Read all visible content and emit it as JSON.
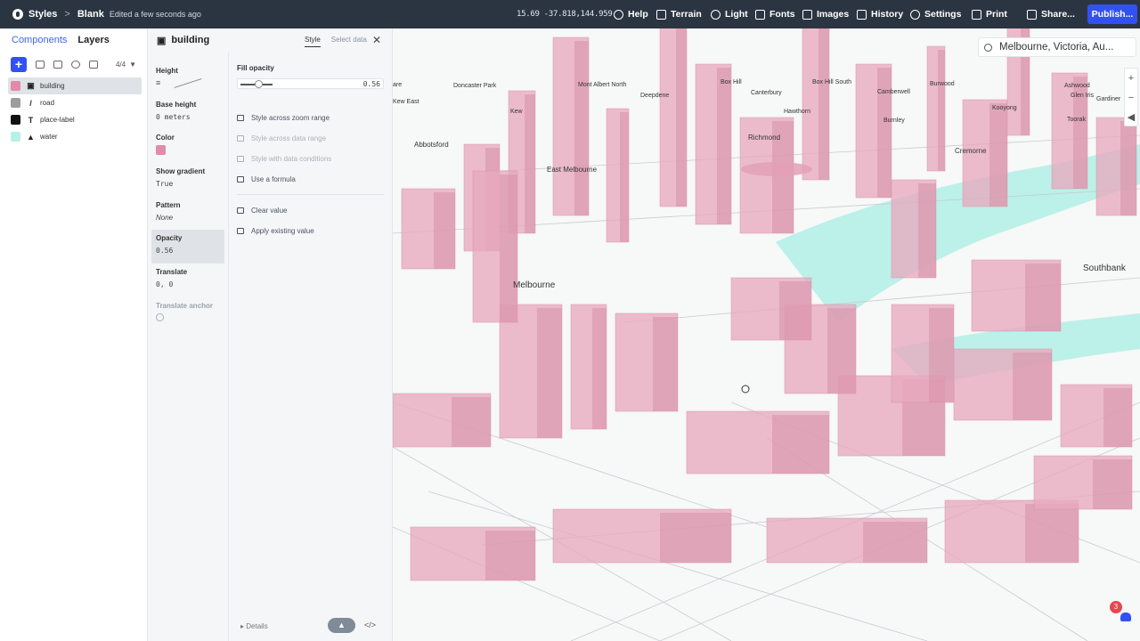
{
  "topbar": {
    "app_title": "Styles",
    "breadcrumb_separator": ">",
    "style_name": "Blank",
    "edited_status": "Edited a few seconds ago",
    "coords": "15.69 -37.818,144.959",
    "menu": [
      {
        "label": "Help",
        "icon": "help-icon"
      },
      {
        "label": "Terrain",
        "icon": "terrain-icon"
      },
      {
        "label": "Light",
        "icon": "light-icon"
      },
      {
        "label": "Fonts",
        "icon": "fonts-icon"
      },
      {
        "label": "Images",
        "icon": "images-icon"
      },
      {
        "label": "History",
        "icon": "history-icon"
      },
      {
        "label": "Settings",
        "icon": "settings-icon"
      },
      {
        "label": "Print",
        "icon": "print-icon"
      },
      {
        "label": "Share...",
        "icon": "share-icon"
      }
    ],
    "publish_label": "Publish..."
  },
  "left_panel": {
    "tabs": [
      {
        "label": "Components"
      },
      {
        "label": "Layers"
      }
    ],
    "active_tab": "Layers",
    "layer_count": "4/4",
    "layers": [
      {
        "name": "building",
        "color": "#e38aa7",
        "type_glyph": "▣",
        "selected": true
      },
      {
        "name": "road",
        "color": "#9e9e9e",
        "type_glyph": "/",
        "selected": false
      },
      {
        "name": "place-label",
        "color": "#111111",
        "type_glyph": "T",
        "selected": false
      },
      {
        "name": "water",
        "color": "#b7f1e6",
        "type_glyph": "▲",
        "selected": false
      }
    ]
  },
  "properties": {
    "layer_name": "building",
    "tabs": [
      {
        "label": "Style"
      },
      {
        "label": "Select data"
      }
    ],
    "items": [
      {
        "label": "Height",
        "value": "",
        "kind": "icon"
      },
      {
        "label": "Base height",
        "value": "0 meters",
        "kind": "mono"
      },
      {
        "label": "Color",
        "value": "",
        "kind": "color",
        "color": "#e38aa7"
      },
      {
        "label": "Show gradient",
        "value": "True",
        "kind": "mono"
      },
      {
        "label": "Pattern",
        "value": "None",
        "kind": "italic"
      },
      {
        "label": "Opacity",
        "value": "0.56",
        "kind": "mono",
        "active": true
      },
      {
        "label": "Translate",
        "value": "0, 0",
        "kind": "mono"
      },
      {
        "label": "Translate anchor",
        "value": "",
        "kind": "icon",
        "disabled": true
      }
    ],
    "editor": {
      "title": "Fill opacity",
      "value": "0.56",
      "slider_fraction": 0.56,
      "options": [
        {
          "label": "Style across zoom range",
          "disabled": false
        },
        {
          "label": "Style across data range",
          "disabled": true
        },
        {
          "label": "Style with data conditions",
          "disabled": true
        },
        {
          "label": "Use a formula",
          "disabled": false
        }
      ],
      "actions": [
        {
          "label": "Clear value"
        },
        {
          "label": "Apply existing value"
        }
      ]
    },
    "footer": {
      "details_label": "Details",
      "code_glyph": "</>"
    }
  },
  "map": {
    "search_value": "Melbourne, Victoria, Au...",
    "labels": [
      {
        "text": "are"
      },
      {
        "text": "Doncaster Park"
      },
      {
        "text": "Mont Albert North"
      },
      {
        "text": "Box Hill"
      },
      {
        "text": "Box Hill South"
      },
      {
        "text": "Burwood"
      },
      {
        "text": "Ashwood"
      },
      {
        "text": "Glen Iris"
      },
      {
        "text": "Gardiner"
      },
      {
        "text": "Ash"
      },
      {
        "text": "Kew East"
      },
      {
        "text": "Deepdene"
      },
      {
        "text": "Canterbury"
      },
      {
        "text": "Camberwell"
      },
      {
        "text": "Kooyong"
      },
      {
        "text": "Kew"
      },
      {
        "text": "Hawthorn"
      },
      {
        "text": "Burnley"
      },
      {
        "text": "Toorak"
      },
      {
        "text": "Richmond"
      },
      {
        "text": "Abbotsford"
      },
      {
        "text": "Cremorne"
      },
      {
        "text": "East Melbourne"
      },
      {
        "text": "Southbank"
      },
      {
        "text": "Melbourne"
      }
    ],
    "notification_count": "3",
    "colors": {
      "building": "#e8a9be",
      "water": "#b4efe5",
      "road": "#c9cbd0"
    }
  }
}
